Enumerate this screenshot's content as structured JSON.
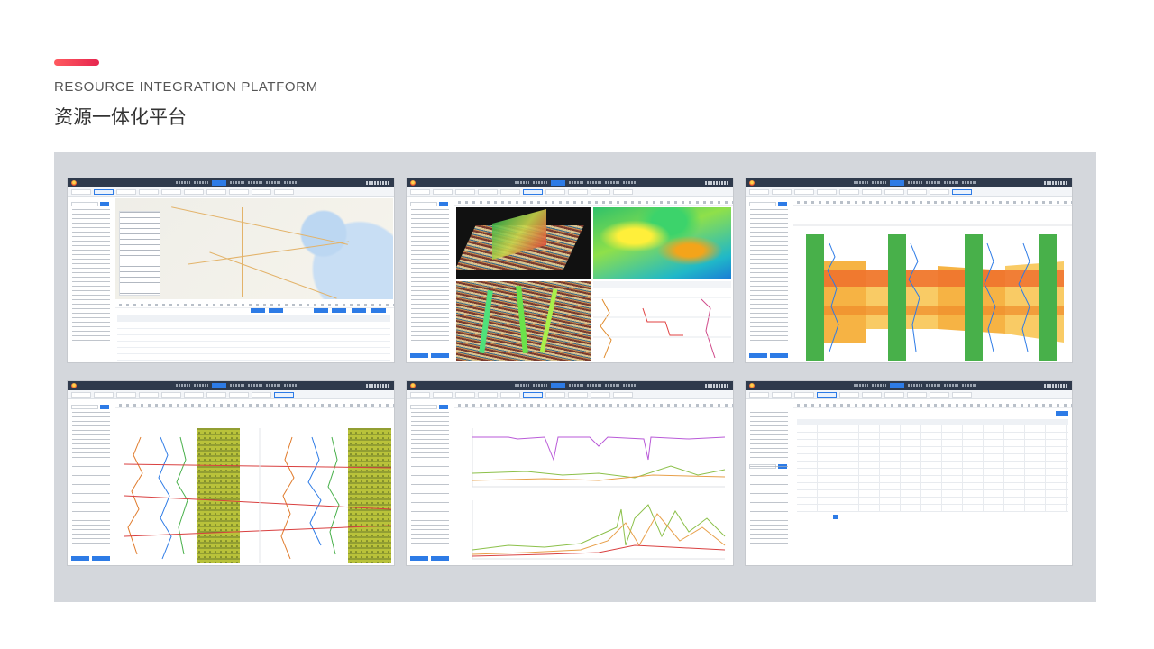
{
  "header": {
    "subtitle": "RESOURCE INTEGRATION PLATFORM",
    "title": "资源一体化平台"
  },
  "colors": {
    "accent_start": "#ff5a5f",
    "accent_end": "#e6254f",
    "panel_bg": "#d4d7dc",
    "app_header": "#2f3a4c",
    "primary_blue": "#2d7be6"
  },
  "screenshots": [
    {
      "name": "map-data-view",
      "content": "map-with-data-table"
    },
    {
      "name": "seismic-3d-view",
      "content": "3d-seismic-and-terrain"
    },
    {
      "name": "well-correlation-view",
      "content": "well-log-correlation-colored-layers"
    },
    {
      "name": "well-log-curves-view",
      "content": "well-log-curves-with-lithology"
    },
    {
      "name": "production-chart-view",
      "content": "production-line-charts"
    },
    {
      "name": "data-table-view",
      "content": "data-grid-table"
    }
  ]
}
